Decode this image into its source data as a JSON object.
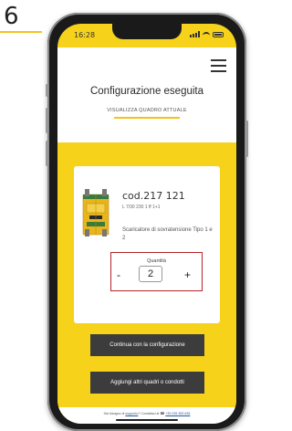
{
  "step": {
    "number": "6",
    "accent_color": "#f4c31a"
  },
  "status_bar": {
    "time": "16:28"
  },
  "header": {
    "menu_icon": "hamburger-menu-icon",
    "title": "Configurazione eseguita",
    "view_link": "VISUALIZZA QUADRO ATTUALE"
  },
  "product": {
    "image_icon": "surge-arrester-module",
    "code": "cod.217 121",
    "reference": "L 7/30 230 1 ff 1+1",
    "description": "Scaricatore di sovratensione Tipo 1 e 2",
    "quantity": {
      "label": "Quantità",
      "value": "2",
      "minus": "-",
      "plus": "+"
    }
  },
  "actions": {
    "continue_label": "Continua con la configurazione",
    "add_label": "Aggiungi altri quadri o condotti"
  },
  "footer": {
    "prefix": "Hai bisogno di",
    "link": "supporto",
    "middle": "? Contattaci al",
    "phone": "+39 035 383 838"
  },
  "colors": {
    "yellow": "#f7d21b",
    "button": "#3c3c3c",
    "highlight_border": "#b4232a"
  }
}
